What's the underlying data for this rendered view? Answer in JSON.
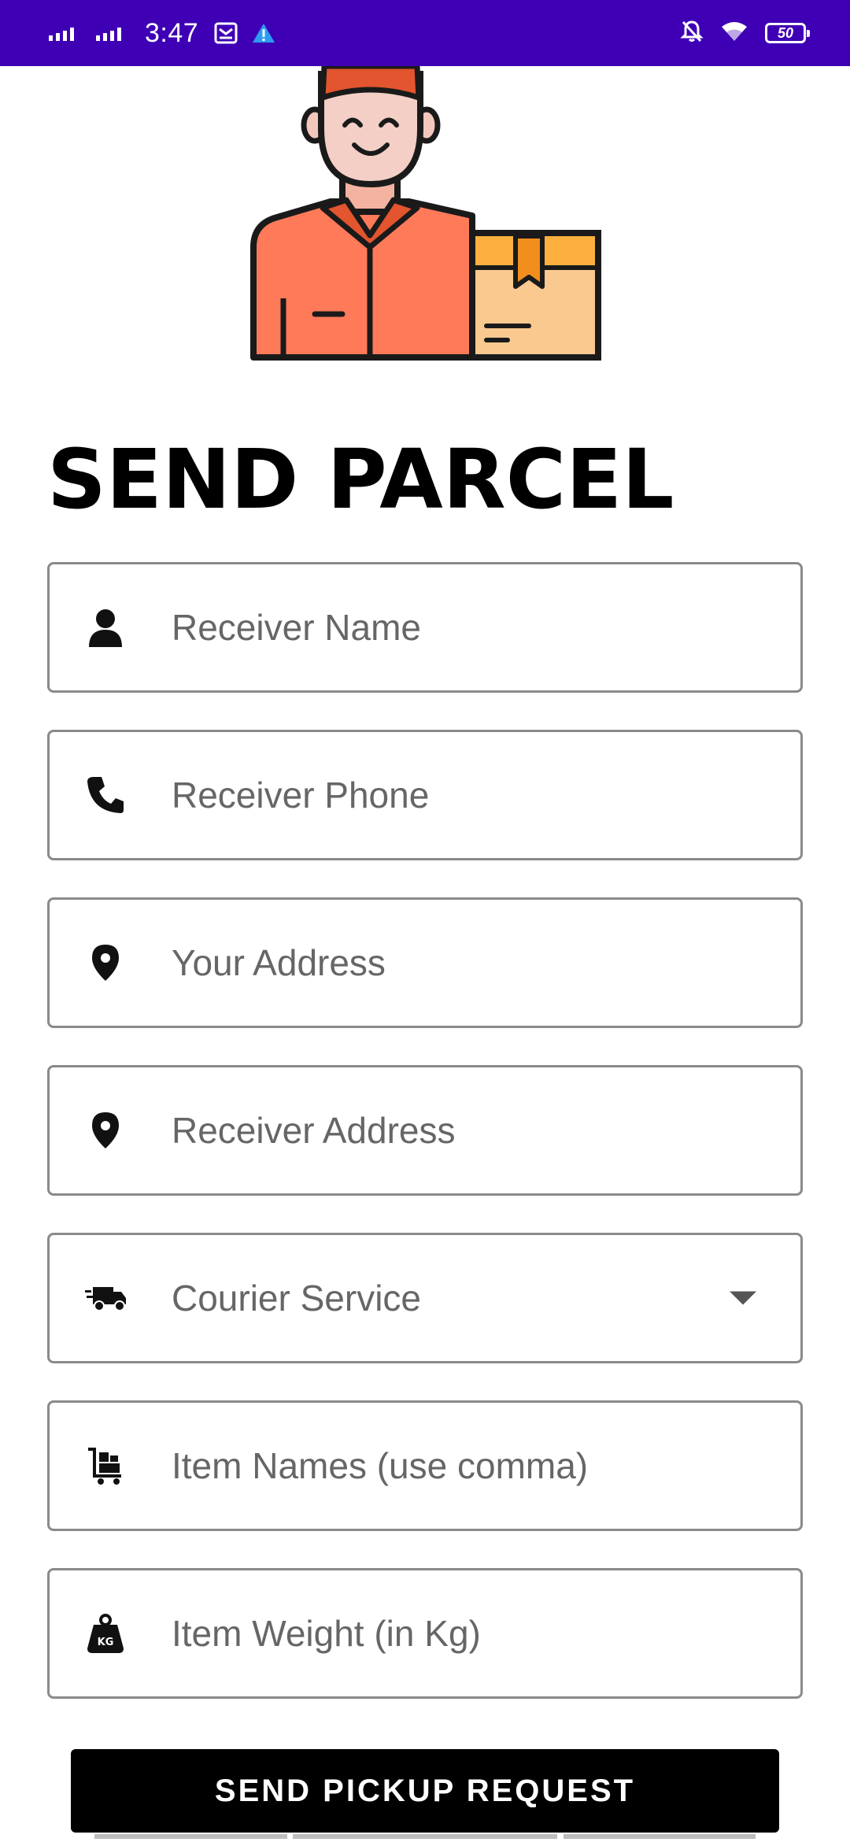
{
  "status_bar": {
    "time": "3:47",
    "battery": "50",
    "icons": [
      "signal-icon",
      "signal-icon",
      "mail-icon",
      "warning-icon",
      "bell-off-icon",
      "wifi-icon",
      "battery-icon"
    ]
  },
  "title": "SEND PARCEL",
  "fields": [
    {
      "icon": "person-icon",
      "placeholder": "Receiver Name"
    },
    {
      "icon": "phone-icon",
      "placeholder": "Receiver Phone"
    },
    {
      "icon": "location-pin-icon",
      "placeholder": "Your Address"
    },
    {
      "icon": "location-pin-icon",
      "placeholder": "Receiver Address"
    },
    {
      "icon": "truck-icon",
      "placeholder": "Courier Service",
      "dropdown": true
    },
    {
      "icon": "cart-icon",
      "placeholder": "Item Names (use comma)"
    },
    {
      "icon": "weight-kg-icon",
      "placeholder": "Item Weight (in Kg)"
    }
  ],
  "submit_label": "SEND PICKUP REQUEST",
  "colors": {
    "status_bar": "#3f00b5",
    "button": "#000000",
    "field_border": "#8a8a8a",
    "placeholder": "#666666",
    "uniform": "#ff7a59",
    "box": "#f9c98f"
  }
}
